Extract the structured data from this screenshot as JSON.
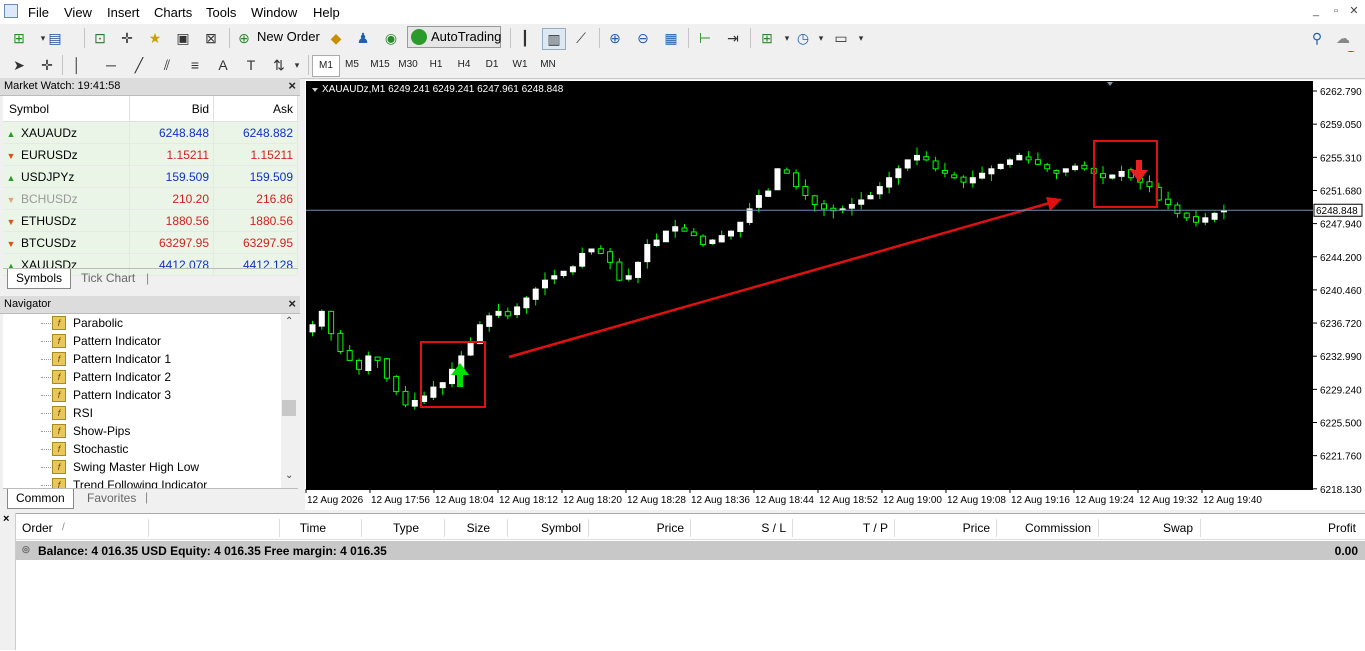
{
  "menu": [
    "File",
    "View",
    "Insert",
    "Charts",
    "Tools",
    "Window",
    "Help"
  ],
  "toolbar": {
    "new_order": "New Order",
    "autotrading": "AutoTrading"
  },
  "periods": [
    "M1",
    "M5",
    "M15",
    "M30",
    "H1",
    "H4",
    "D1",
    "W1",
    "MN"
  ],
  "notification_count": "1",
  "market_watch": {
    "title": "Market Watch: 19:41:58",
    "columns": [
      "Symbol",
      "Bid",
      "Ask"
    ],
    "rows": [
      {
        "symbol": "XAUAUDz",
        "bid": "6248.848",
        "ask": "6248.882",
        "dir": "up",
        "color": "#1030c8"
      },
      {
        "symbol": "EURUSDz",
        "bid": "1.15211",
        "ask": "1.15211",
        "dir": "down",
        "color": "#d42020"
      },
      {
        "symbol": "USDJPYz",
        "bid": "159.509",
        "ask": "159.509",
        "dir": "up",
        "color": "#1030c8"
      },
      {
        "symbol": "BCHUSDz",
        "bid": "210.20",
        "ask": "216.86",
        "dir": "down",
        "color": "#d42020",
        "dim": true
      },
      {
        "symbol": "ETHUSDz",
        "bid": "1880.56",
        "ask": "1880.56",
        "dir": "down",
        "color": "#d42020"
      },
      {
        "symbol": "BTCUSDz",
        "bid": "63297.95",
        "ask": "63297.95",
        "dir": "down",
        "color": "#d42020"
      },
      {
        "symbol": "XAUUSDz",
        "bid": "4412.078",
        "ask": "4412.128",
        "dir": "up",
        "color": "#1030c8"
      }
    ],
    "tabs": [
      "Symbols",
      "Tick Chart"
    ]
  },
  "navigator": {
    "title": "Navigator",
    "items": [
      "Parabolic",
      "Pattern Indicator",
      "Pattern Indicator 1",
      "Pattern Indicator 2",
      "Pattern Indicator 3",
      "RSI",
      "Show-Pips",
      "Stochastic",
      "Swing Master High Low",
      "Trend Following Indicator"
    ],
    "tabs": [
      "Common",
      "Favorites"
    ]
  },
  "chart": {
    "header": "XAUAUDz,M1  6249.241 6249.241 6247.961 6248.848",
    "price_labels": [
      "6262.790",
      "6259.050",
      "6255.310",
      "6251.680",
      "6247.940",
      "6244.200",
      "6240.460",
      "6236.720",
      "6232.990",
      "6229.240",
      "6225.500",
      "6221.760",
      "6218.130"
    ],
    "current_price": "6248.848",
    "time_labels": [
      "12 Aug 2026",
      "12 Aug 17:56",
      "12 Aug 18:04",
      "12 Aug 18:12",
      "12 Aug 18:20",
      "12 Aug 18:28",
      "12 Aug 18:36",
      "12 Aug 18:44",
      "12 Aug 18:52",
      "12 Aug 19:00",
      "12 Aug 19:08",
      "12 Aug 19:16",
      "12 Aug 19:24",
      "12 Aug 19:32",
      "12 Aug 19:40"
    ],
    "colors": {
      "bg": "#000000",
      "bull": "#ffffff",
      "bear": "#00ff00",
      "wick": "#00ff00",
      "bid_line": "#6f8faf",
      "annotation": "#e01010",
      "buy_arrow": "#00e000",
      "sell_arrow": "#e82020"
    }
  },
  "chart_data": {
    "type": "candlestick",
    "symbol": "XAUAUDz",
    "timeframe": "M1",
    "ylim": [
      6218.13,
      6262.79
    ],
    "close_path": [
      6236.0,
      6237.5,
      6235.0,
      6233.0,
      6232.0,
      6231.0,
      6232.5,
      6232.0,
      6230.0,
      6228.5,
      6227.0,
      6227.5,
      6228.0,
      6229.0,
      6229.5,
      6231.0,
      6232.5,
      6234.0,
      6236.0,
      6237.0,
      6237.5,
      6237.0,
      6238.0,
      6239.0,
      6240.0,
      6241.0,
      6241.5,
      6242.0,
      6242.5,
      6244.0,
      6244.5,
      6244.0,
      6243.0,
      6241.0,
      6241.5,
      6243.0,
      6245.0,
      6245.5,
      6246.5,
      6247.0,
      6246.5,
      6246.0,
      6245.0,
      6245.5,
      6246.0,
      6246.5,
      6247.5,
      6249.0,
      6250.5,
      6251.0,
      6253.5,
      6253.0,
      6251.5,
      6250.5,
      6249.5,
      6249.0,
      6248.8,
      6249.0,
      6249.5,
      6250.0,
      6250.5,
      6251.5,
      6252.5,
      6253.5,
      6254.5,
      6255.0,
      6254.5,
      6253.5,
      6253.0,
      6252.5,
      6252.0,
      6252.5,
      6253.0,
      6253.5,
      6254.0,
      6254.5,
      6255.0,
      6254.5,
      6254.0,
      6253.5,
      6253.0,
      6253.5,
      6253.8,
      6253.5,
      6253.0,
      6252.5,
      6252.8,
      6253.2,
      6252.5,
      6252.0,
      6251.5,
      6250.0,
      6249.5,
      6248.5,
      6248.0,
      6247.5,
      6248.0,
      6248.5,
      6248.8
    ],
    "annotations": [
      {
        "type": "buy-signal",
        "time": "12 Aug 18:04"
      },
      {
        "type": "sell-signal",
        "time": "12 Aug 19:32"
      }
    ]
  },
  "terminal": {
    "columns": [
      "Order",
      "/",
      "Time",
      "Type",
      "Size",
      "Symbol",
      "Price",
      "S / L",
      "T / P",
      "Price",
      "Commission",
      "Swap",
      "Profit"
    ],
    "balance_text": "Balance: 4 016.35 USD  Equity: 4 016.35  Free margin: 4 016.35",
    "profit": "0.00"
  }
}
